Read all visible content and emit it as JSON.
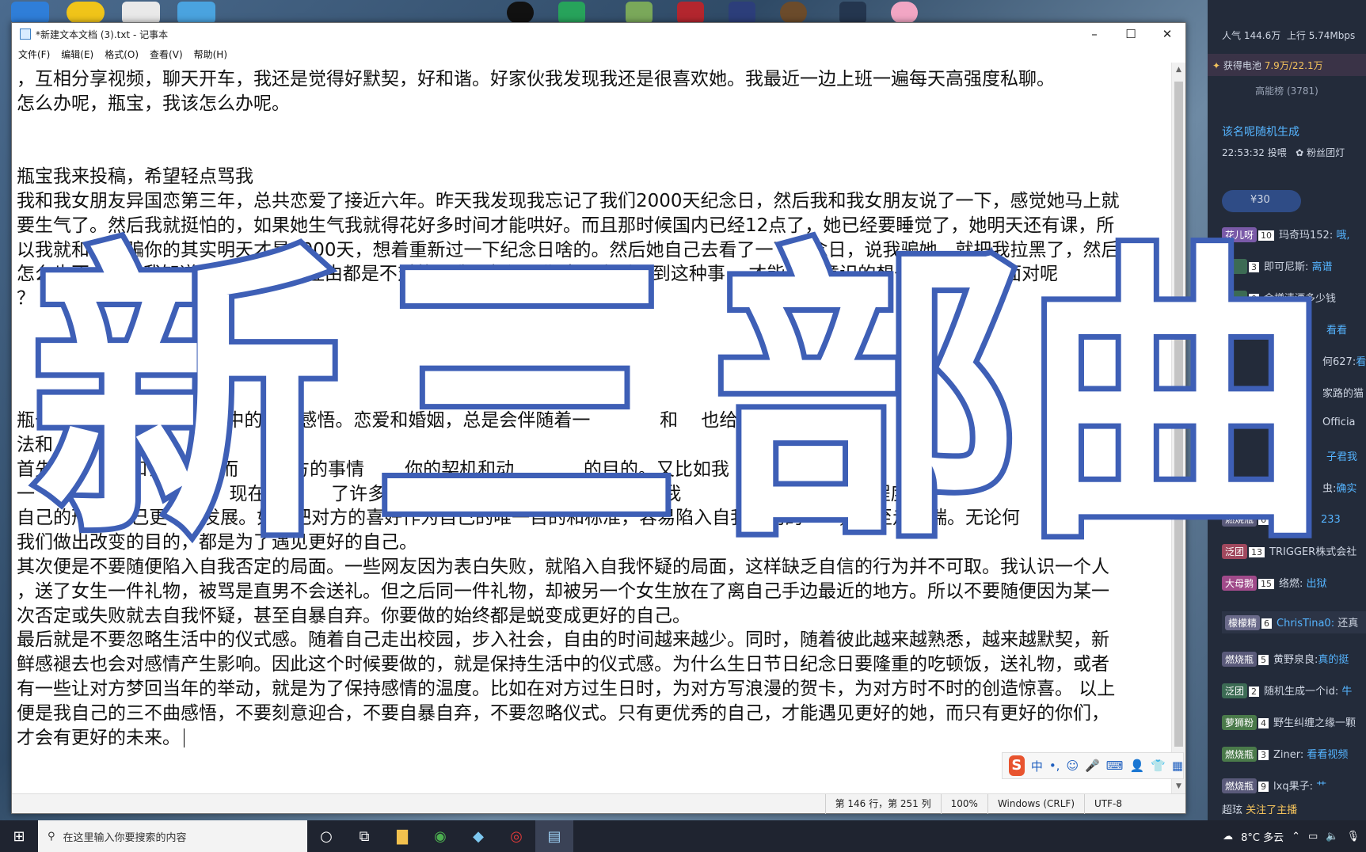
{
  "notepad": {
    "title": "*新建文本文档 (3).txt - 记事本",
    "menu": [
      "文件(F)",
      "编辑(E)",
      "格式(O)",
      "查看(V)",
      "帮助(H)"
    ],
    "lines": [
      "，互相分享视频，聊天开车，我还是觉得好默契，好和谐。好家伙我发现我还是很喜欢她。我最近一边上班一遍每天高强度私聊。",
      "怎么办呢，瓶宝，我该怎么办呢。",
      "",
      "",
      "瓶宝我来投稿，希望轻点骂我",
      "我和我女朋友异国恋第三年，总共恋爱了接近六年。昨天我发现我忘记了我们2000天纪念日，然后我和我女朋友说了一下，感觉她马上就",
      "要生气了。然后我就挺怕的，如果她生气我就得花好多时间才能哄好。而且那时候国内已经12点了，她已经要睡觉了，她明天还有课，所",
      "以我就和她说骗你的其实明天才是2000天，想着重新过一下纪念日啥的。然后她自己去看了一下纪念日，说我骗她，就把我拉黑了，然后",
      "怎么也不   话。我知道骗   管是什么理由都是不对的，我只想问下瓶宝，之后遇到这种事    才能不下意识的想去掩饰而是去面对呢",
      "？  谢谢啦",
      "",
      "",
      "",
      "",
      "瓶于           在恋爱及婚姻中的一些感悟。恋爱和婚姻，总是会伴随着一            和    也给予了我一",
      "法和",
      "首先          合和讨好对方而      对方的事情       你的契机和动            的目的。又比如我",
      "一            话合         人，现在说话     了许多，虽然可能是因为有了在意的       我           自己希望在一定程度上",
      "自己的形    自己更      发展。如果把对方的喜好作为自己的唯一目的和标准，容易陷入自我感动的      ，甚至走极端。无论何",
      "我们做出改变的目的，都是为了遇见更好的自己。",
      "其次便是不要随便陷入自我否定的局面。一些网友因为表白失败，就陷入自我怀疑的局面，这样缺乏自信的行为并不可取。我认识一个人",
      "，送了女生一件礼物，被骂是直男不会送礼。但之后同一件礼物，却被另一个女生放在了离自己手边最近的地方。所以不要随便因为某一",
      "次否定或失败就去自我怀疑，甚至自暴自弃。你要做的始终都是蜕变成更好的自己。",
      "最后就是不要忽略生活中的仪式感。随着自己走出校园，步入社会，自由的时间越来越少。同时，随着彼此越来越熟悉，越来越默契，新",
      "鲜感褪去也会对感情产生影响。因此这个时候要做的，就是保持生活中的仪式感。为什么生日节日纪念日要隆重的吃顿饭，送礼物，或者",
      "有一些让对方梦回当年的举动，就是为了保持感情的温度。比如在对方过生日时，为对方写浪漫的贺卡，为对方时不时的创造惊喜。 以上",
      "便是我自己的三不曲感悟，不要刻意迎合，不要自暴自弃，不要忽略仪式。只有更优秀的自己，才能遇见更好的她，而只有更好的你们，",
      "才会有更好的未来。"
    ],
    "status": {
      "position": "第 146 行，第 251 列",
      "zoom": "100%",
      "eol": "Windows (CRLF)",
      "encoding": "UTF-8"
    }
  },
  "overlay": {
    "chars": [
      "新",
      "三",
      "部",
      "曲"
    ],
    "stroke_color": "#3e5fb6"
  },
  "ime": {
    "mode": "中",
    "punct": "•,"
  },
  "panel": {
    "popularity_label": "人气",
    "popularity": "144.6万",
    "upload_label": "上行",
    "upload": "5.74Mbps",
    "battery_label": "获得电池",
    "battery": "7.9万/22.1万",
    "rank": "高能榜 (3781)",
    "gen_title": "该名呢随机生成",
    "time": "22:53:32 投喂",
    "fan": "粉丝团灯",
    "gift": "¥30",
    "chat": [
      {
        "badge": "花儿呀",
        "lv": "10",
        "user": "玛奇玛152:",
        "msg": "哦,"
      },
      {
        "badge": "",
        "lv": "3",
        "user": "即可尼斯:",
        "msg": "离谱"
      },
      {
        "badge": "",
        "lv": "0",
        "user": "金樽清酒多少钱",
        "msg": ""
      },
      {
        "badge": "",
        "lv": "",
        "user": "",
        "msg": "看看"
      },
      {
        "badge": "",
        "lv": "",
        "user": "何627:",
        "msg": "看"
      },
      {
        "badge": "",
        "lv": "",
        "user": "家路的猫",
        "msg": ""
      },
      {
        "badge": "",
        "lv": "",
        "user": "Officia",
        "msg": ""
      },
      {
        "badge": "",
        "lv": "",
        "user": "",
        "msg": "子君我"
      },
      {
        "badge": "",
        "lv": "",
        "user": "虫:",
        "msg": "确实"
      },
      {
        "badge": "燃烧瓶",
        "lv": "6",
        "user": "",
        "msg": "233"
      },
      {
        "badge": "泛团",
        "lv": "13",
        "user": "TRIGGER株式会社",
        "msg": ""
      },
      {
        "badge": "大母鹅",
        "lv": "15",
        "user": "络燃:",
        "msg": "出狱"
      },
      {
        "badge": "檬檬精",
        "lv": "6",
        "user": "ChrisTina0:",
        "msg": "还真"
      },
      {
        "badge": "燃烧瓶",
        "lv": "5",
        "user": "黄野泉良:",
        "msg": "真的挺"
      },
      {
        "badge": "泛团",
        "lv": "2",
        "user": "随机生成一个id:",
        "msg": "牛"
      },
      {
        "badge": "萝狮粉",
        "lv": "4",
        "user": "野生纠缠之缘一颗",
        "msg": ""
      },
      {
        "badge": "燃烧瓶",
        "lv": "3",
        "user": "Ziner:",
        "msg": "看看视频"
      },
      {
        "badge": "燃烧瓶",
        "lv": "9",
        "user": "lxq果子:",
        "msg": "艹"
      }
    ],
    "follow_user": "超玹",
    "follow_msg": "关注了主播"
  },
  "taskbar": {
    "search_placeholder": "在这里输入你要搜索的内容",
    "weather": "8°C 多云"
  }
}
